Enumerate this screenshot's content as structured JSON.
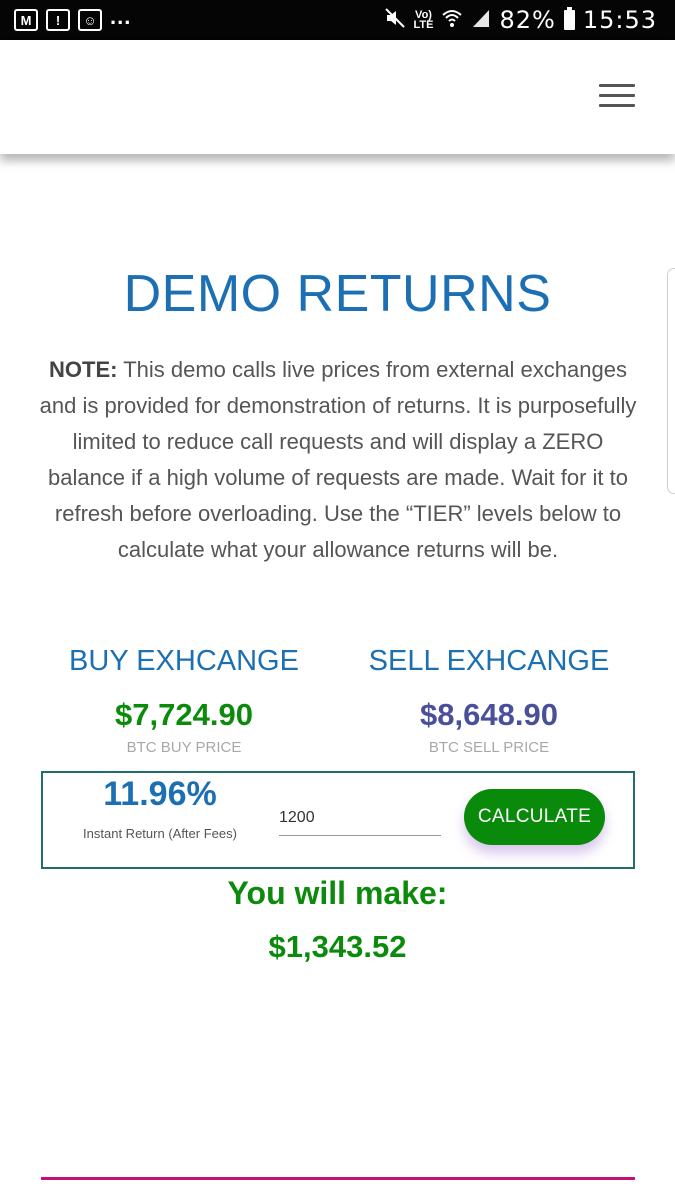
{
  "status_bar": {
    "icons": [
      "gmail-icon",
      "alert-icon",
      "face-icon"
    ],
    "more": "...",
    "volte": "Vo)",
    "lte": "LTE",
    "battery": "82%",
    "time": "15:53"
  },
  "header": {
    "menu_icon": "hamburger-menu-icon"
  },
  "main": {
    "title": "DEMO RETURNS",
    "note_label": "NOTE:",
    "note_text": " This demo calls live prices from external exchanges and is provided for demonstration of returns. It is purposefully limited to reduce call requests and will display a ZERO balance if a high volume of requests are made. Wait for it to refresh before overloading. Use the “TIER” levels below to calculate what your allowance returns will be."
  },
  "exchanges": {
    "buy": {
      "title": "BUY EXHCANGE",
      "price": "$7,724.90",
      "label": "BTC BUY PRICE",
      "color": "#0b8a0b"
    },
    "sell": {
      "title": "SELL EXHCANGE",
      "price": "$8,648.90",
      "label": "BTC SELL PRICE",
      "color": "#4a4f9a"
    }
  },
  "calculator": {
    "return_percent": "11.96%",
    "return_label": "Instant Return (After Fees)",
    "amount_value": "1200",
    "button_label": "CALCULATE",
    "button_color": "#0a8a0a"
  },
  "result": {
    "label": "You will make:",
    "value": "$1,343.52"
  },
  "colors": {
    "accent_blue": "#1c6fb3",
    "profit_green": "#0b8a0b",
    "box_border": "#1f6f6a",
    "divider_magenta": "#c0137a"
  }
}
